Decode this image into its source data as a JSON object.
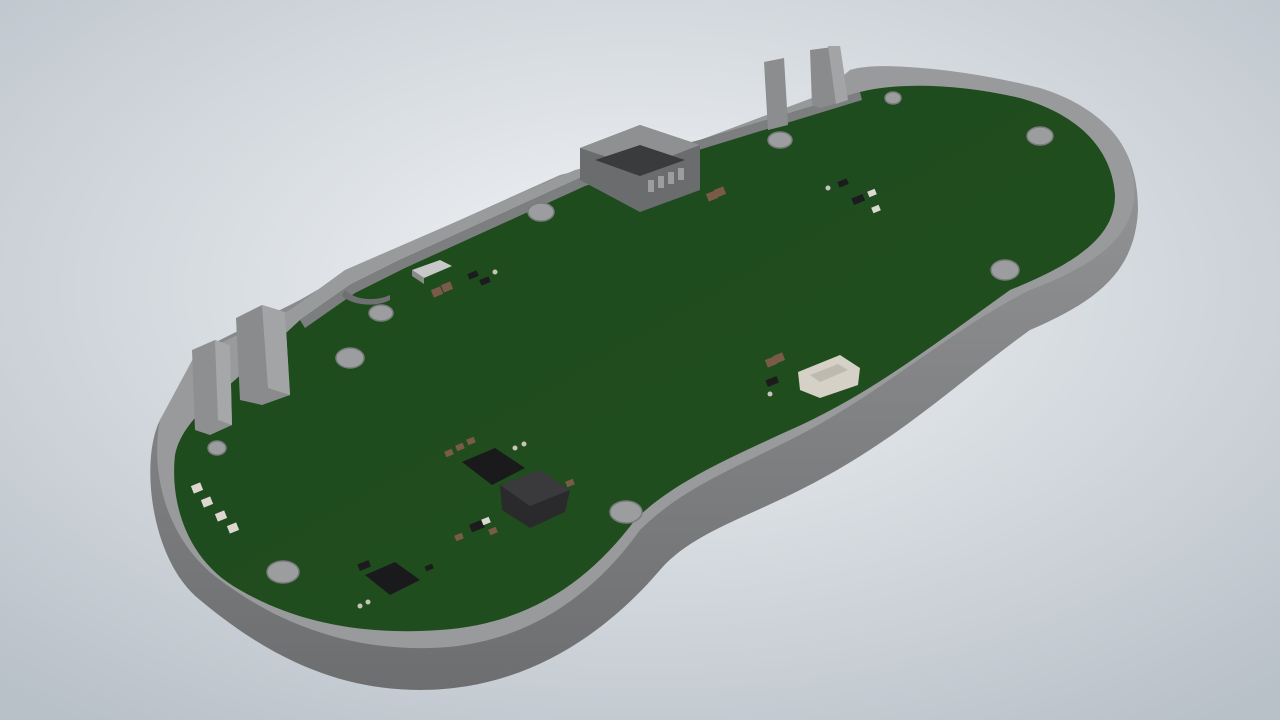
{
  "scene": {
    "subject": "pcb-in-enclosure-render",
    "colors": {
      "background_light": "#eef1f4",
      "background_dark": "#bcc3ca",
      "enclosure": "#8c8c8e",
      "enclosure_shadow": "#6f7072",
      "enclosure_highlight": "#a4a5a7",
      "pcb": "#1f4a1e",
      "pcb_dark": "#173a17",
      "component_dark": "#1c1c1e",
      "component_grey": "#6e6e70",
      "pad_light": "#d8d4cc",
      "capacitor_brown": "#7a5a48"
    }
  }
}
